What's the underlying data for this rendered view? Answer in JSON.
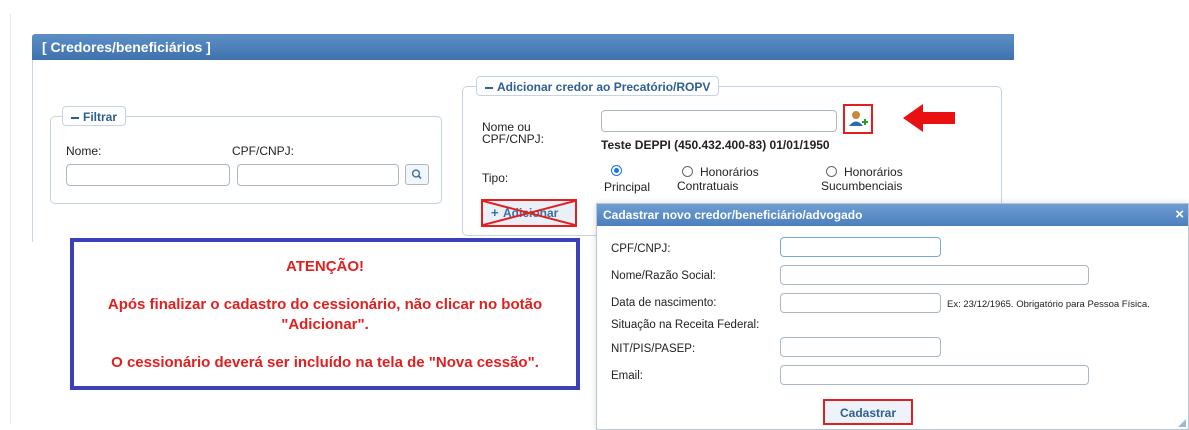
{
  "header": {
    "title": "[ Credores/beneficiários ]"
  },
  "filter": {
    "legend": "Filtrar",
    "name_label": "Nome:",
    "cpf_label": "CPF/CNPJ:",
    "name_value": "",
    "cpf_value": ""
  },
  "add_creditor": {
    "legend": "Adicionar credor ao Precatório/ROPV",
    "name_label_line1": "Nome ou",
    "name_label_line2": "CPF/CNPJ:",
    "name_value": "",
    "selected_text": "Teste DEPPI (450.432.400-83) 01/01/1950",
    "type_label": "Tipo:",
    "types": [
      {
        "line1": "Principal",
        "line2": "",
        "checked": true
      },
      {
        "line1": "Honorários",
        "line2": "Contratuais",
        "checked": false
      },
      {
        "line1": "Honorários",
        "line2": "Sucumbenciais",
        "checked": false
      }
    ],
    "add_button_label": "Adicionar"
  },
  "attention": {
    "title": "ATENÇÃO!",
    "line1": "Após finalizar o cadastro do cessionário, não clicar no botão",
    "line2": "\"Adicionar\".",
    "line3": "O cessionário deverá ser incluído na tela de \"Nova cessão\"."
  },
  "modal": {
    "title": "Cadastrar novo credor/beneficiário/advogado",
    "close_glyph": "×",
    "fields": {
      "cpf_label": "CPF/CNPJ:",
      "name_label": "Nome/Razão Social:",
      "birth_label": "Data de nascimento:",
      "birth_hint": "Ex: 23/12/1965. Obrigatório para Pessoa Física.",
      "status_label": "Situação na Receita Federal:",
      "nit_label": "NIT/PIS/PASEP:",
      "email_label": "Email:"
    },
    "submit_label": "Cadastrar"
  },
  "colors": {
    "header_blue": "#4a7db8",
    "annotation_red": "#e02020",
    "attention_border": "#3b3fb8"
  },
  "icons": {
    "add_person": "add-user-icon",
    "search": "search-icon",
    "arrow": "red-arrow-left"
  }
}
